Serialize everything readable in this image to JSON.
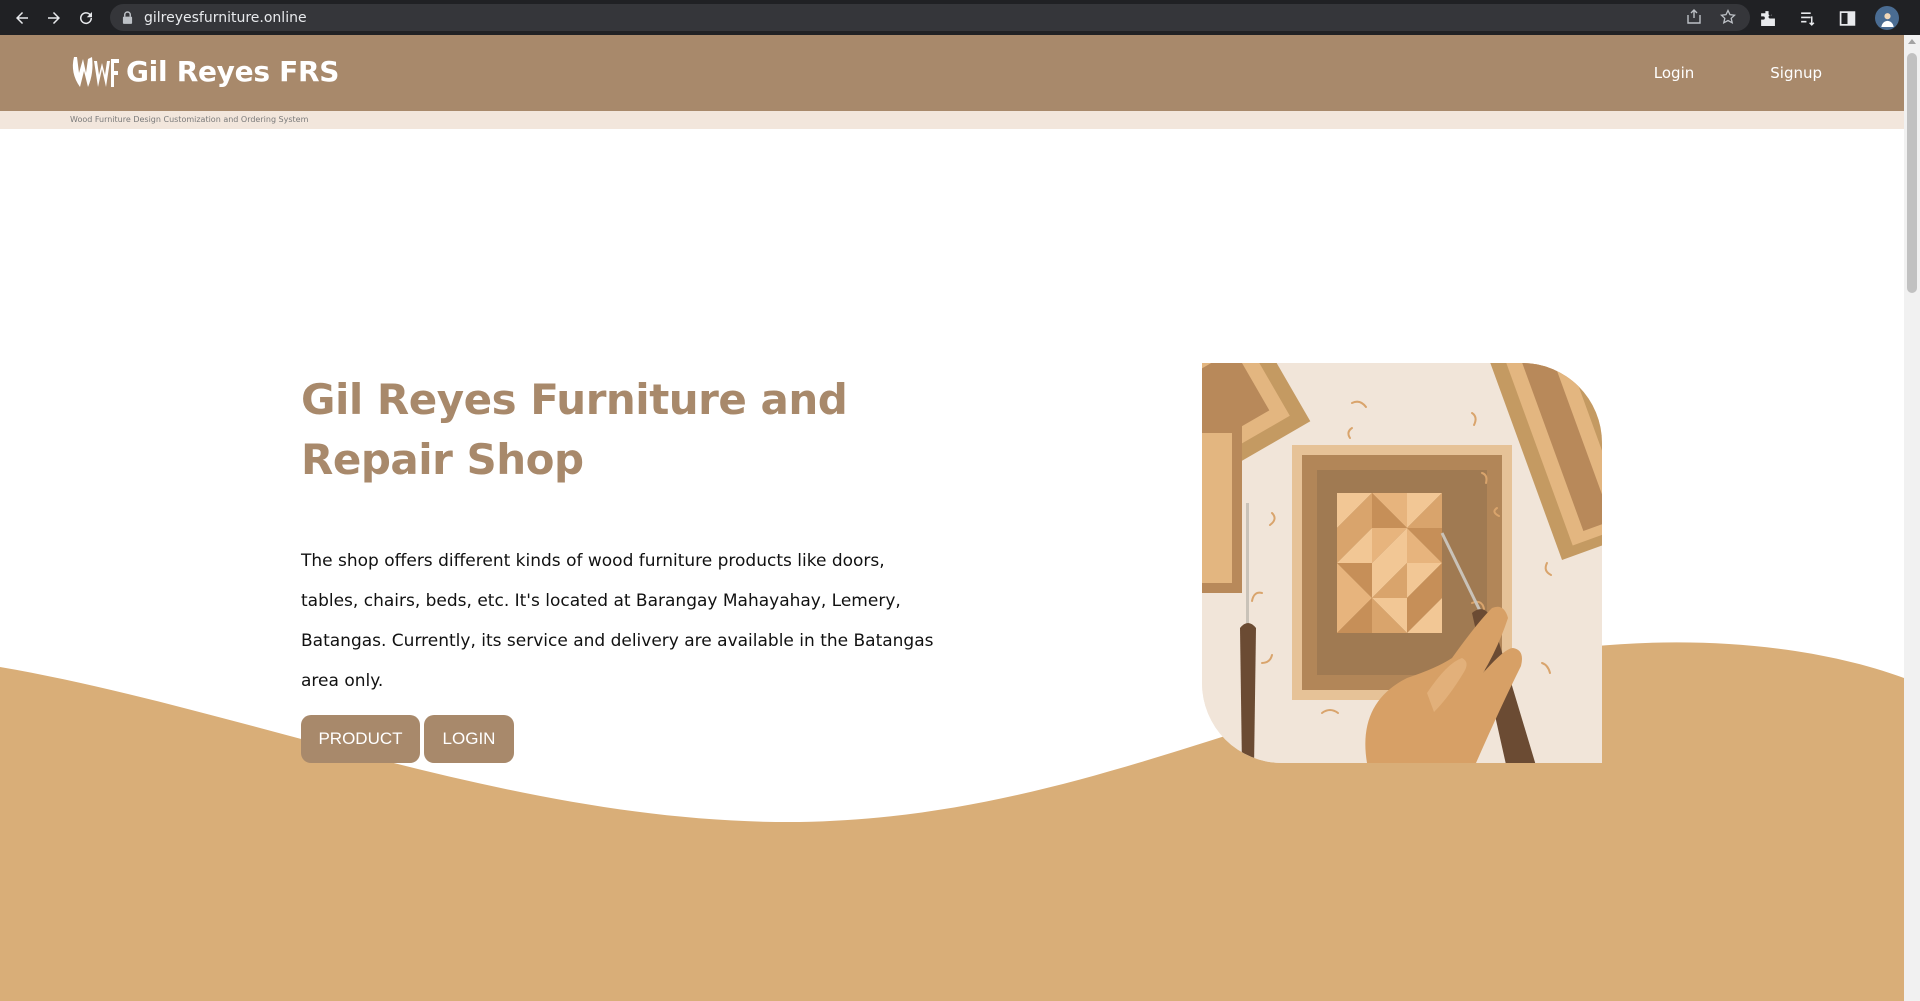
{
  "browser": {
    "url": "gilreyesfurniture.online"
  },
  "header": {
    "brand": "Gil Reyes FRS",
    "logo_text": "GWF",
    "nav": [
      {
        "label": "Login"
      },
      {
        "label": "Signup"
      }
    ],
    "tagline": "Wood Furniture Design Customization and Ordering System"
  },
  "hero": {
    "title": "Gil Reyes Furniture and Repair Shop",
    "description": "The shop offers different kinds of wood furniture products like doors, tables, chairs, beds, etc. It's located at Barangay Mahayahay, Lemery, Batangas. Currently, its service and delivery are available in the Batangas area only.",
    "buttons": [
      {
        "label": "PRODUCT"
      },
      {
        "label": "LOGIN"
      }
    ]
  },
  "colors": {
    "brand": "#a8896b",
    "wave": "#d9ae78",
    "tagline_bg": "#f2e6dc",
    "chrome": "#202124"
  },
  "icons": [
    "back-icon",
    "forward-icon",
    "reload-icon",
    "lock-icon",
    "share-icon",
    "star-icon",
    "extensions-icon",
    "reading-list-icon",
    "side-panel-icon",
    "profile-avatar",
    "menu-icon"
  ]
}
